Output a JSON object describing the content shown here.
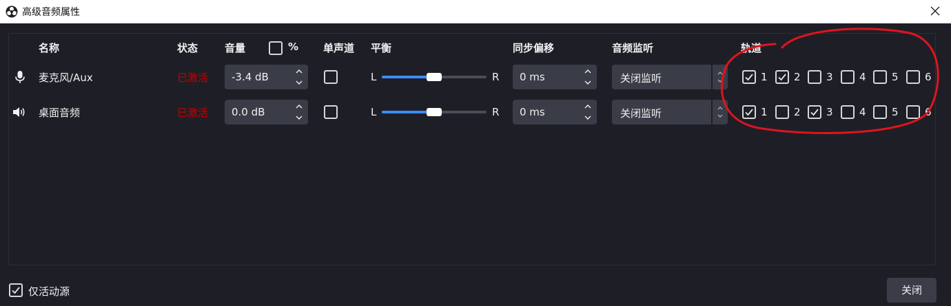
{
  "window": {
    "title": "高级音频属性",
    "app_icon": "obs-logo-icon",
    "close_icon": "close-icon"
  },
  "headers": {
    "name": "名称",
    "status": "状态",
    "volume": "音量",
    "percent": "%",
    "percent_checked": false,
    "mono": "单声道",
    "balance": "平衡",
    "sync_offset": "同步偏移",
    "monitoring": "音频监听",
    "tracks": "轨道"
  },
  "rows": [
    {
      "icon": "microphone-icon",
      "name": "麦克风/Aux",
      "status": "已激活",
      "volume": "-3.4 dB",
      "mono": false,
      "balance_left": "L",
      "balance_right": "R",
      "balance_value": 0.5,
      "sync_offset": "0 ms",
      "monitoring": "关闭监听",
      "tracks": [
        {
          "label": "1",
          "checked": true
        },
        {
          "label": "2",
          "checked": true
        },
        {
          "label": "3",
          "checked": false
        },
        {
          "label": "4",
          "checked": false
        },
        {
          "label": "5",
          "checked": false
        },
        {
          "label": "6",
          "checked": false
        }
      ]
    },
    {
      "icon": "speaker-icon",
      "name": "桌面音频",
      "status": "已激活",
      "volume": "0.0 dB",
      "mono": false,
      "balance_left": "L",
      "balance_right": "R",
      "balance_value": 0.5,
      "sync_offset": "0 ms",
      "monitoring": "关闭监听",
      "tracks": [
        {
          "label": "1",
          "checked": true
        },
        {
          "label": "2",
          "checked": false
        },
        {
          "label": "3",
          "checked": true
        },
        {
          "label": "4",
          "checked": false
        },
        {
          "label": "5",
          "checked": false
        },
        {
          "label": "6",
          "checked": false
        }
      ]
    }
  ],
  "footer": {
    "active_only_label": "仅活动源",
    "active_only_checked": true,
    "close_button": "关闭"
  },
  "colors": {
    "background": "#1e1f26",
    "control": "#3a3d48",
    "status_active": "#c40000",
    "slider_fill": "#3d8bff",
    "annotation": "#e0141e"
  }
}
